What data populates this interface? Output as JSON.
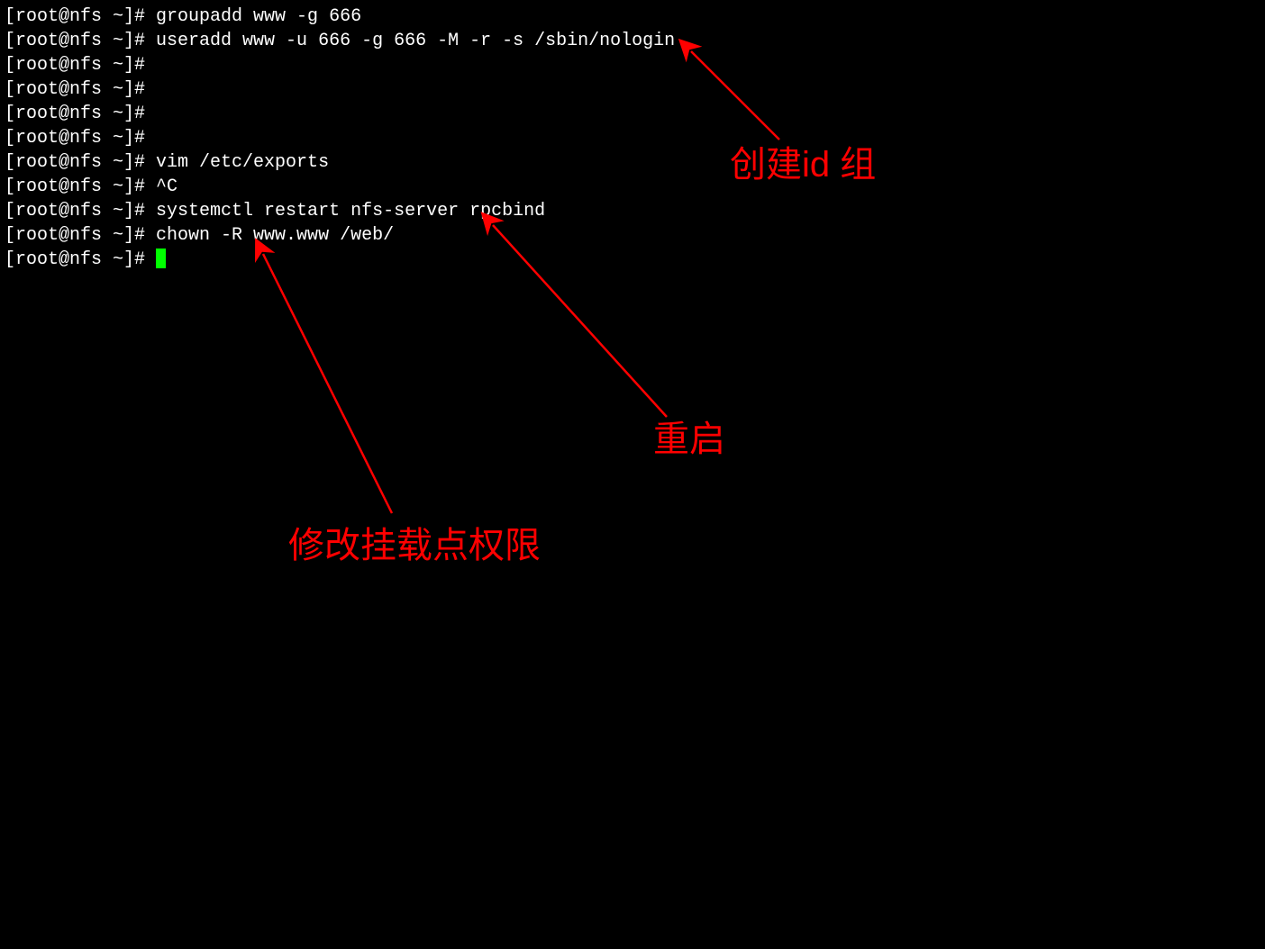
{
  "terminal": {
    "prompt": "[root@nfs ~]#",
    "lines": [
      {
        "prompt": "[root@nfs ~]#",
        "command": " groupadd www -g 666"
      },
      {
        "prompt": "[root@nfs ~]#",
        "command": " useradd www -u 666 -g 666 -M -r -s /sbin/nologin"
      },
      {
        "prompt": "[root@nfs ~]#",
        "command": ""
      },
      {
        "prompt": "[root@nfs ~]#",
        "command": ""
      },
      {
        "prompt": "[root@nfs ~]#",
        "command": ""
      },
      {
        "prompt": "[root@nfs ~]#",
        "command": ""
      },
      {
        "prompt": "[root@nfs ~]#",
        "command": " vim /etc/exports"
      },
      {
        "prompt": "[root@nfs ~]#",
        "command": " ^C"
      },
      {
        "prompt": "[root@nfs ~]#",
        "command": " systemctl restart nfs-server rpcbind"
      },
      {
        "prompt": "[root@nfs ~]#",
        "command": " chown -R www.www /web/"
      },
      {
        "prompt": "[root@nfs ~]#",
        "command": " ",
        "cursor": true
      }
    ]
  },
  "annotations": {
    "create_id_group": "创建id 组",
    "restart": "重启",
    "modify_mount_permissions": "修改挂载点权限"
  }
}
